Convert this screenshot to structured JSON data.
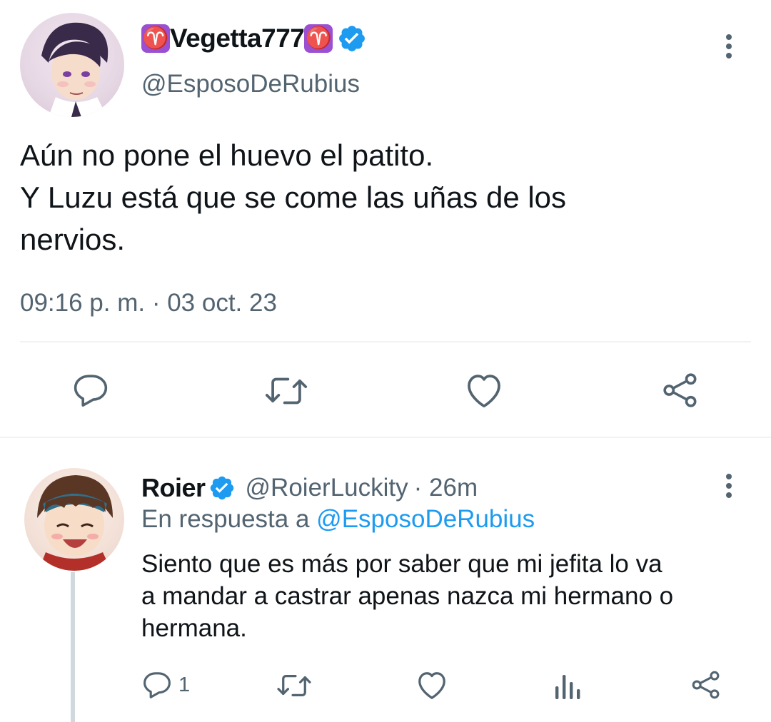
{
  "main_tweet": {
    "display_name": "Vegetta777",
    "handle": "@EsposoDeRubius",
    "text_line1": "Aún no pone el huevo el patito.",
    "text_line2": "Y Luzu está que se come las uñas de los",
    "text_line3": "nervios.",
    "timestamp": "09:16 p. m. · 03 oct. 23",
    "name_emoji": "♈",
    "actions": [
      "reply-icon",
      "retweet-icon",
      "like-icon",
      "share-icon"
    ]
  },
  "reply_tweet": {
    "display_name": "Roier",
    "handle": "@RoierLuckity",
    "time": "· 26m",
    "replying_prefix": "En respuesta a",
    "replying_to": "@EsposoDeRubius",
    "text_line1": "Siento que es más por saber que mi jefita lo va",
    "text_line2": "a mandar a castrar apenas nazca mi hermano o",
    "text_line3": "hermana.",
    "reply_count": "1",
    "actions": [
      "reply-icon",
      "retweet-icon",
      "like-icon",
      "views-icon",
      "share-icon"
    ]
  },
  "colors": {
    "accent": "#1d9bf0",
    "secondary_text": "#536471",
    "aries_badge": "#9b4fd1"
  }
}
